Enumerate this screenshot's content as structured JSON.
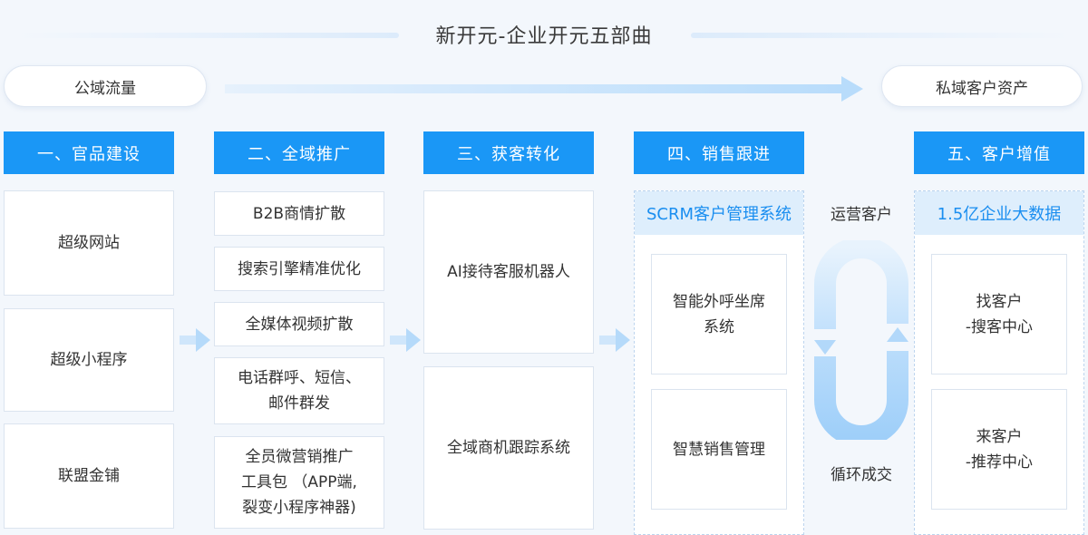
{
  "title": "新开元-企业开元五部曲",
  "flow": {
    "left": "公域流量",
    "right": "私域客户资产"
  },
  "stages": [
    {
      "header": "一、官品建设",
      "items": [
        "超级网站",
        "超级小程序",
        "联盟金铺"
      ]
    },
    {
      "header": "二、全域推广",
      "items": [
        "B2B商情扩散",
        "搜索引擎精准优化",
        "全媒体视频扩散",
        "电话群呼、短信、\n邮件群发",
        "全员微营销推广\n工具包 （APP端,\n裂变小程序神器)"
      ]
    },
    {
      "header": "三、获客转化",
      "items": [
        "AI接待客服机器人",
        "全域商机跟踪系统"
      ]
    },
    {
      "header": "四、销售跟进",
      "panel_title": "SCRM客户管理系统",
      "items": [
        "智能外呼坐席\n系统",
        "智慧销售管理"
      ]
    },
    {
      "header": "五、客户增值",
      "panel_title": "1.5亿企业大数据",
      "items": [
        "找客户\n-搜客中心",
        "来客户\n-推荐中心"
      ]
    }
  ],
  "cycle": {
    "top_label": "运营客户",
    "bottom_label": "循环成交"
  },
  "colors": {
    "accent": "#1a97f6",
    "panel_head_bg": "#deeefc",
    "panel_head_text": "#1a8ef0",
    "background": "#f3f7fc"
  }
}
